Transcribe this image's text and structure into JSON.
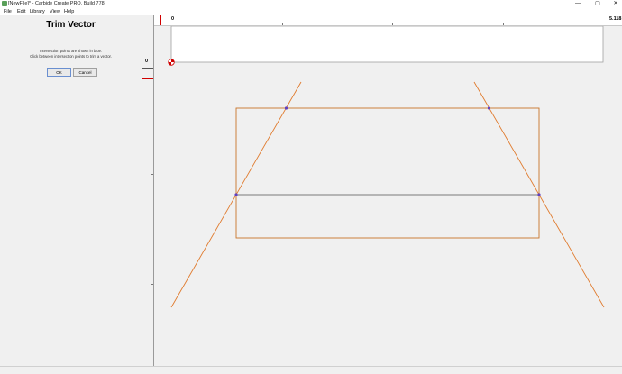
{
  "window": {
    "title": "[NewFile]* - Carbide Create PRO, Build 778",
    "minimize_glyph": "—",
    "maximize_glyph": "▢",
    "close_glyph": "✕"
  },
  "menu": {
    "items": [
      "File",
      "Edit",
      "Library",
      "View",
      "Help"
    ]
  },
  "panel": {
    "title": "Trim Vector",
    "line1": "Intersection points are shown in blue.",
    "line2": "Click between intersection points to trim a vector.",
    "ok_label": "OK",
    "cancel_label": "Cancel"
  },
  "ruler": {
    "vertical_zero": "0",
    "horizontal_zero": "0",
    "horizontal_max": "5.118"
  },
  "colors": {
    "vector_line": "#e07b2e",
    "rectangle": "#c8742a",
    "trim_line": "#7a7a7a",
    "intersection_point": "#6040c0",
    "stock_border": "#a0a0a0",
    "ruler_marker": "#d00000"
  },
  "icons": {
    "app": "carbide-create-icon",
    "origin": "origin-marker-icon"
  }
}
